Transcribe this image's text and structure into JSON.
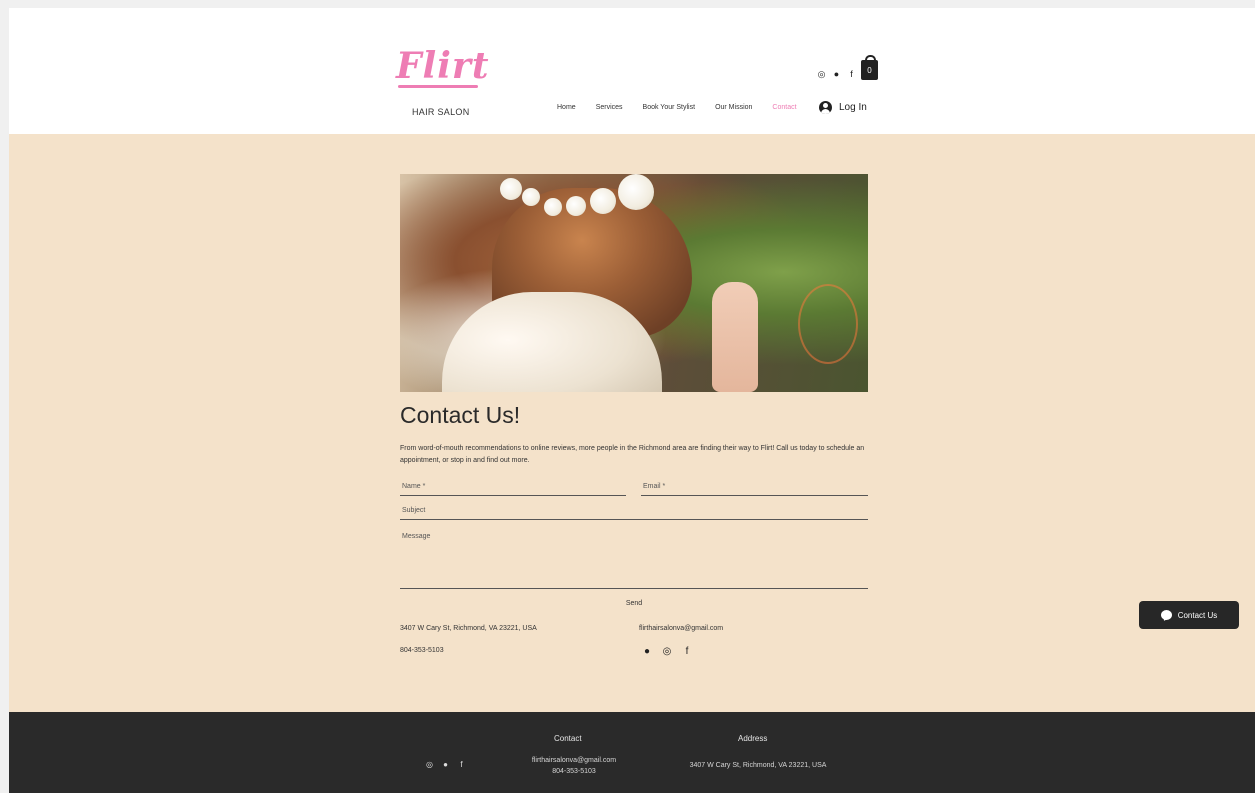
{
  "brand": {
    "logo_text": "Flirt",
    "tagline": "HAIR SALON",
    "accent_color": "#ee7db4"
  },
  "header": {
    "social_icons": [
      "instagram-icon",
      "map-pin-icon",
      "facebook-icon"
    ],
    "cart_count": "0",
    "nav": [
      {
        "label": "Home",
        "active": false
      },
      {
        "label": "Services",
        "active": false
      },
      {
        "label": "Book Your Stylist",
        "active": false
      },
      {
        "label": "Our Mission",
        "active": false
      },
      {
        "label": "Contact",
        "active": true
      }
    ],
    "login_label": "Log In"
  },
  "main": {
    "heading": "Contact Us!",
    "intro": "From word-of-mouth recommendations to online reviews, more people in the Richmond area are finding their way to Flirt! Call us today to schedule an appointment, or stop in and find out more.",
    "form": {
      "name_label": "Name *",
      "email_label": "Email *",
      "subject_label": "Subject",
      "message_label": "Message",
      "send_label": "Send"
    },
    "address": "3407 W Cary St, Richmond, VA 23221, USA",
    "phone": "804-353-5103",
    "email": "flirthairsalonva@gmail.com",
    "social_icons": [
      "map-pin-icon",
      "instagram-icon",
      "facebook-icon"
    ]
  },
  "chat": {
    "label": "Contact Us"
  },
  "footer": {
    "contact_heading": "Contact",
    "address_heading": "Address",
    "email": "flirthairsalonva@gmail.com",
    "phone": "804-353-5103",
    "address": "3407 W Cary St, Richmond, VA 23221, USA",
    "social_icons": [
      "instagram-icon",
      "map-pin-icon",
      "facebook-icon"
    ]
  }
}
